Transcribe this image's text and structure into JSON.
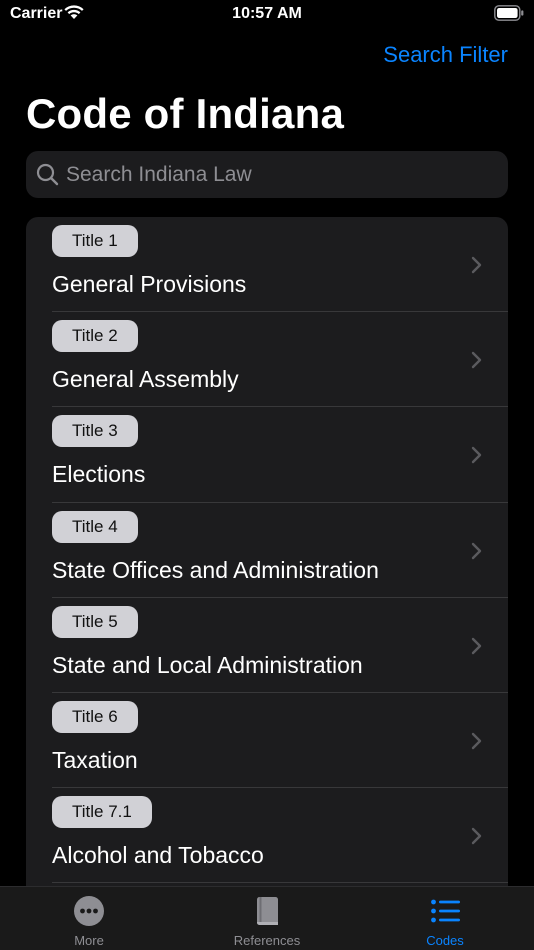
{
  "status_bar": {
    "carrier": "Carrier",
    "time": "10:57 AM"
  },
  "nav": {
    "search_filter_label": "Search Filter",
    "title": "Code of Indiana"
  },
  "search": {
    "placeholder": "Search Indiana Law",
    "value": ""
  },
  "titles": [
    {
      "badge": "Title 1",
      "name": "General Provisions"
    },
    {
      "badge": "Title 2",
      "name": "General Assembly"
    },
    {
      "badge": "Title 3",
      "name": "Elections"
    },
    {
      "badge": "Title 4",
      "name": "State Offices and Administration"
    },
    {
      "badge": "Title 5",
      "name": "State and Local Administration"
    },
    {
      "badge": "Title 6",
      "name": "Taxation"
    },
    {
      "badge": "Title 7.1",
      "name": "Alcohol and Tobacco"
    }
  ],
  "tab_bar": {
    "tabs": [
      {
        "label": "More",
        "icon": "ellipsis-circle-icon",
        "active": false
      },
      {
        "label": "References",
        "icon": "book-icon",
        "active": false
      },
      {
        "label": "Codes",
        "icon": "list-icon",
        "active": true
      }
    ]
  },
  "colors": {
    "accent": "#0a84ff",
    "background": "#000000",
    "card": "#1c1c1e",
    "badge": "#d1d1d6"
  }
}
